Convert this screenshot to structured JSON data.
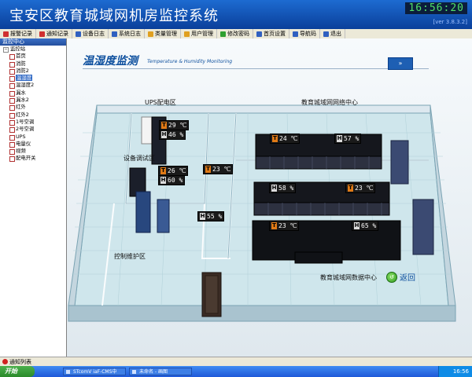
{
  "app": {
    "title": "宝安区教育城域网机房监控系统",
    "clock": "16:56:20",
    "version": "[ver 3.8.3.2]"
  },
  "menu": [
    {
      "label": "报警记录",
      "icon": "alarm-record-icon",
      "color": "#d03030"
    },
    {
      "label": "通知记录",
      "icon": "notify-record-icon",
      "color": "#d03030"
    },
    {
      "label": "设备日志",
      "icon": "device-log-icon",
      "color": "#3060c0"
    },
    {
      "label": "系统日志",
      "icon": "system-log-icon",
      "color": "#3060c0"
    },
    {
      "label": "类量管理",
      "icon": "quantity-manage-icon",
      "color": "#e0a020"
    },
    {
      "label": "用户管理",
      "icon": "user-manage-icon",
      "color": "#e0a020"
    },
    {
      "label": "修改密码",
      "icon": "password-icon",
      "color": "#30a030"
    },
    {
      "label": "首页设置",
      "icon": "home-settings-icon",
      "color": "#3060c0"
    },
    {
      "label": "导航码",
      "icon": "navigation-icon",
      "color": "#3060c0"
    },
    {
      "label": "退出",
      "icon": "exit-icon",
      "color": "#3060c0"
    }
  ],
  "sidebar": {
    "header": "监控中心",
    "root": "监控站",
    "items": [
      {
        "label": "首页",
        "selected": false
      },
      {
        "label": "消防",
        "selected": false
      },
      {
        "label": "消防2",
        "selected": false
      },
      {
        "label": "温湿度",
        "selected": true
      },
      {
        "label": "温湿度2",
        "selected": false
      },
      {
        "label": "漏水",
        "selected": false
      },
      {
        "label": "漏水2",
        "selected": false
      },
      {
        "label": "红外",
        "selected": false
      },
      {
        "label": "红外2",
        "selected": false
      },
      {
        "label": "1号空调",
        "selected": false
      },
      {
        "label": "2号空调",
        "selected": false
      },
      {
        "label": "UPS",
        "selected": false
      },
      {
        "label": "电量仪",
        "selected": false
      },
      {
        "label": "视频",
        "selected": false
      },
      {
        "label": "配电开关",
        "selected": false
      }
    ]
  },
  "page": {
    "title": "温湿度监测",
    "subtitle": "Temperature & Humidity Monitoring",
    "nav_label": "»",
    "back_label": "返回"
  },
  "areas": {
    "ups": "UPS配电区",
    "network_center": "教育城域网网络中心",
    "equipment_test": "设备调试区",
    "control": "控制维护区",
    "data_center": "教育城域网数据中心"
  },
  "sensors": {
    "ups_t": {
      "tag": "T",
      "value": "29 ℃"
    },
    "ups_h": {
      "tag": "H",
      "value": "46 %"
    },
    "test_t": {
      "tag": "T",
      "value": "26 ℃"
    },
    "test_h": {
      "tag": "H",
      "value": "60 %"
    },
    "corridor_t": {
      "tag": "T",
      "value": "23 ℃"
    },
    "control_h": {
      "tag": "H",
      "value": "55 %"
    },
    "net_t": {
      "tag": "T",
      "value": "24 ℃"
    },
    "net_h": {
      "tag": "H",
      "value": "57 %"
    },
    "mid_h": {
      "tag": "H",
      "value": "58 %"
    },
    "mid_t": {
      "tag": "T",
      "value": "23 ℃"
    },
    "dc_t": {
      "tag": "T",
      "value": "23 ℃"
    },
    "dc_h": {
      "tag": "H",
      "value": "65 %"
    }
  },
  "statusbar": {
    "text": "通知列表"
  },
  "taskbar": {
    "start": "开始",
    "tasks": [
      "STcomV iaF-CMS中",
      "未命名 - 画图"
    ],
    "clock": "16:56"
  }
}
